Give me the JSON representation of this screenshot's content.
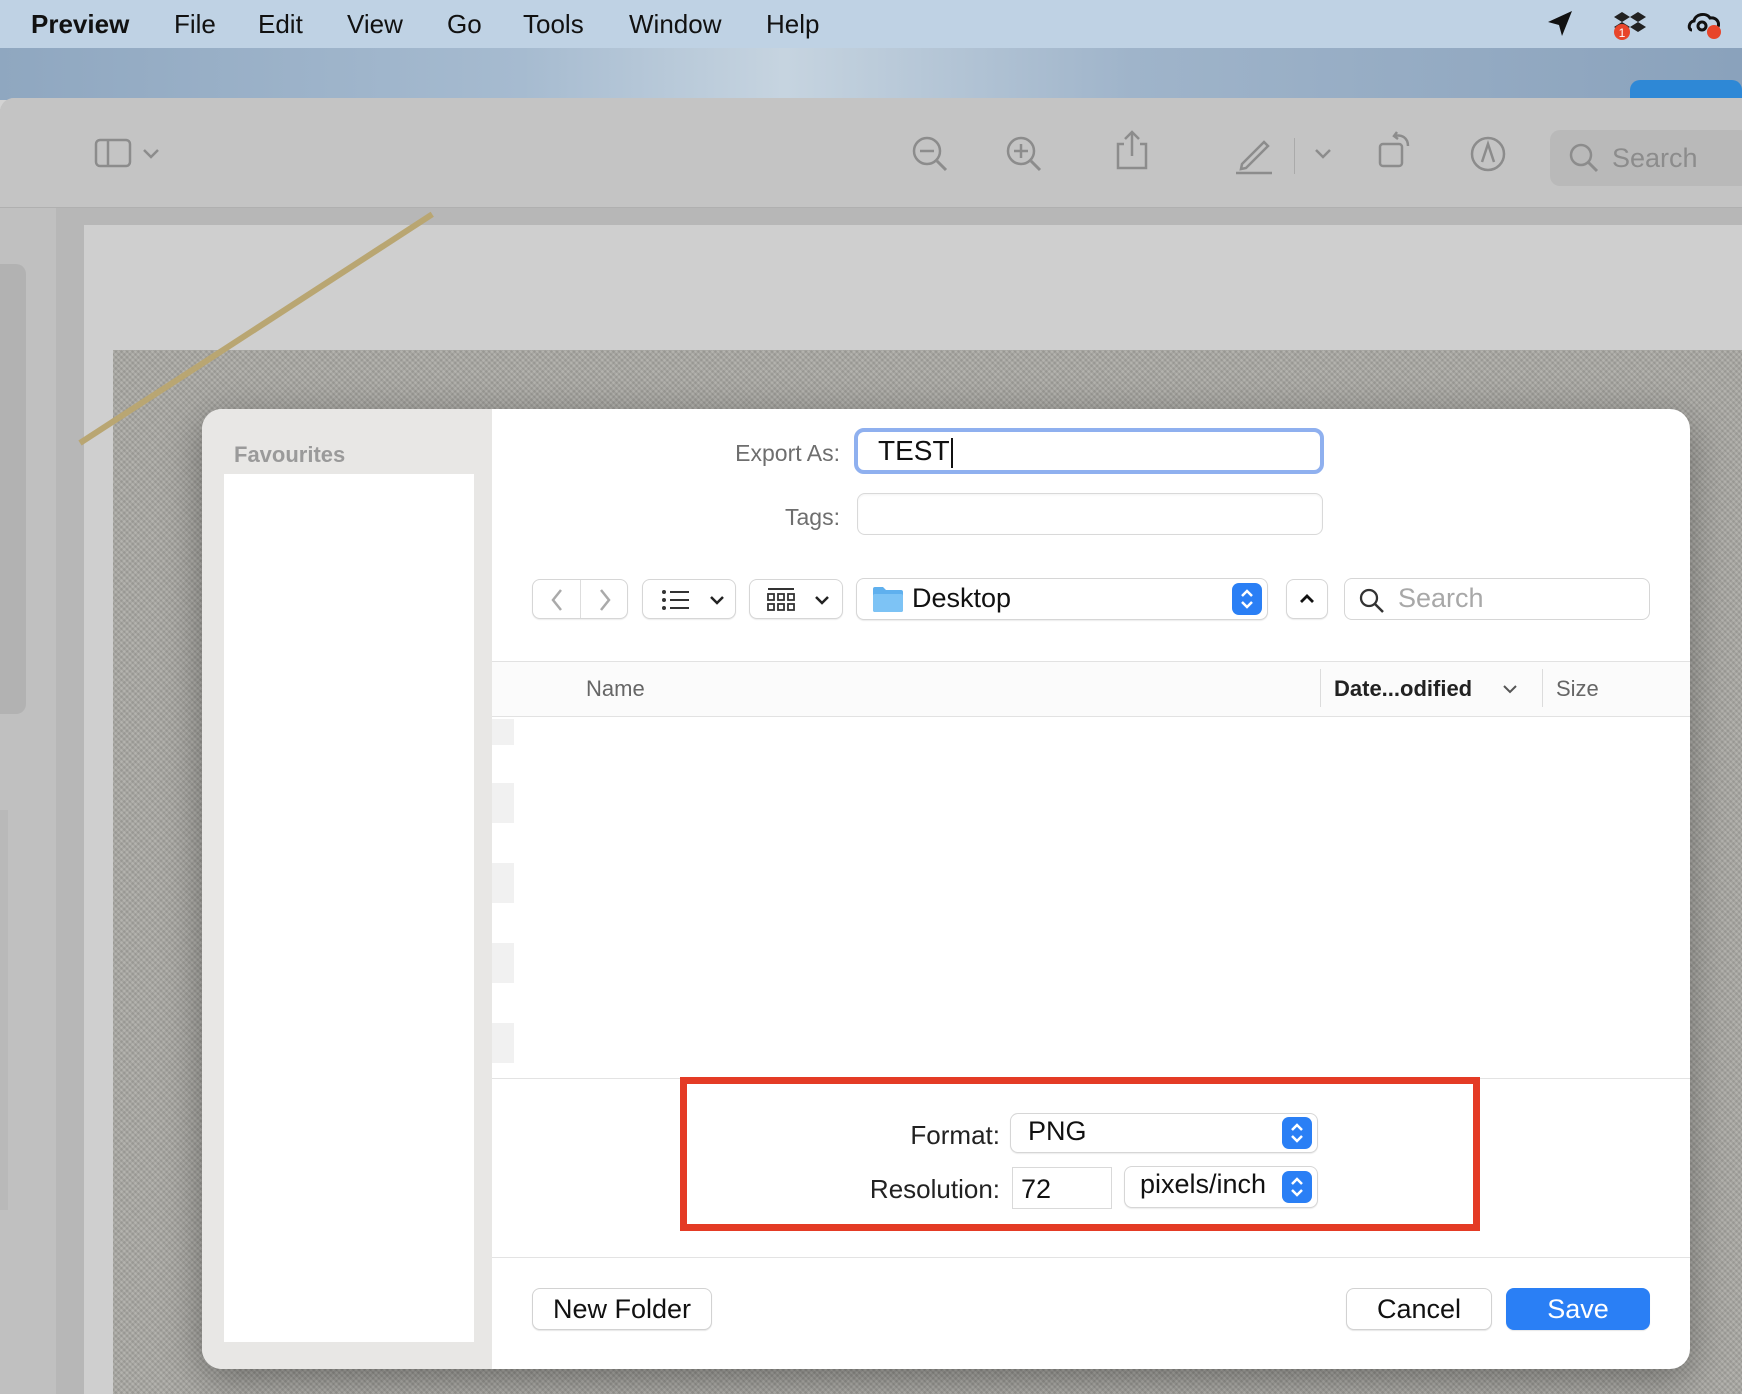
{
  "menubar": {
    "app_name": "Preview",
    "items": [
      "File",
      "Edit",
      "View",
      "Go",
      "Tools",
      "Window",
      "Help"
    ],
    "status_icons": [
      "location-arrow-icon",
      "dropbox-icon",
      "creative-cloud-icon"
    ],
    "dropbox_badge": "1"
  },
  "toolbar": {
    "search_placeholder": "Search",
    "icons": [
      "sidebar-toggle-icon",
      "zoom-out-icon",
      "zoom-in-icon",
      "share-icon",
      "markup-pen-icon",
      "rotate-icon",
      "annotate-icon",
      "search-icon"
    ]
  },
  "dialog": {
    "sidebar": {
      "title": "Favourites"
    },
    "export_as": {
      "label": "Export As:",
      "value": "TEST"
    },
    "tags": {
      "label": "Tags:",
      "value": ""
    },
    "location": {
      "value": "Desktop",
      "icon": "folder-icon"
    },
    "search": {
      "placeholder": "Search"
    },
    "columns": {
      "name": "Name",
      "date_modified": "Date...odified",
      "size": "Size"
    },
    "format": {
      "label": "Format:",
      "value": "PNG"
    },
    "resolution": {
      "label": "Resolution:",
      "value": "72",
      "unit": "pixels/inch"
    },
    "buttons": {
      "new_folder": "New Folder",
      "cancel": "Cancel",
      "save": "Save"
    }
  },
  "colors": {
    "menubar_bg": "#bfd2e4",
    "accent_blue": "#2a7ff5",
    "highlight_red": "#e43b25",
    "focus_ring": "#8fb0ef"
  }
}
